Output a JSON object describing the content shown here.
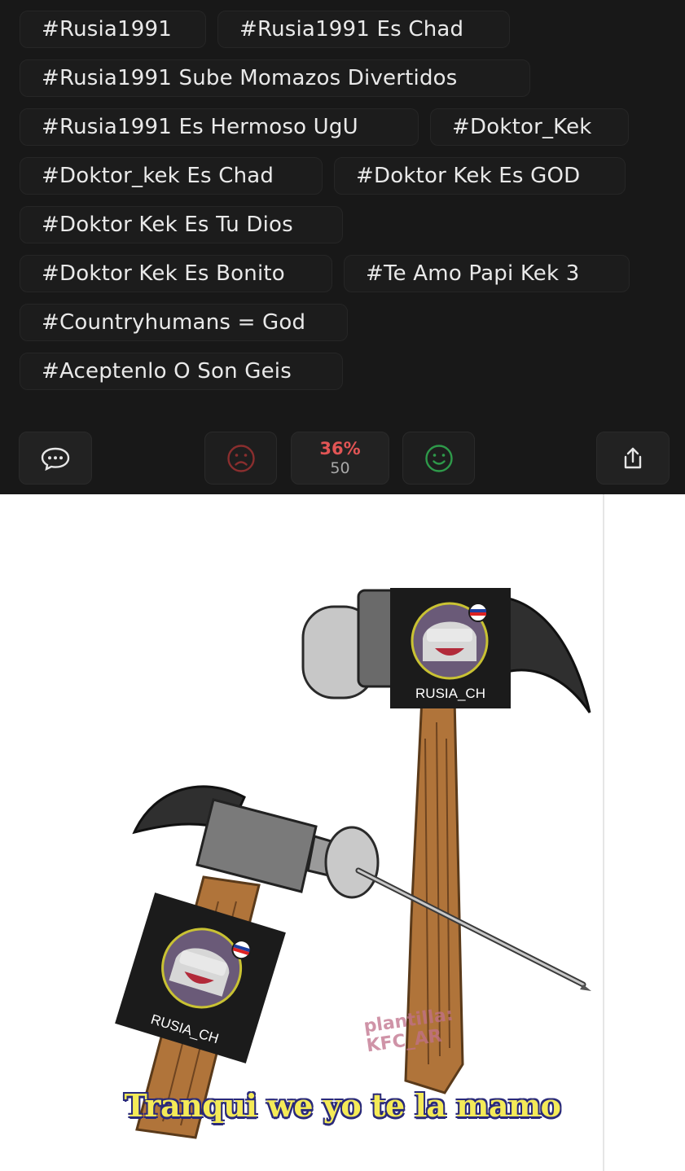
{
  "tags": [
    "#Rusia1991",
    "#Rusia1991 Es Chad",
    "#Rusia1991 Sube Momazos Divertidos",
    "#Rusia1991 Es Hermoso UgU",
    "#Doktor_Kek",
    "#Doktor_kek Es Chad",
    "#Doktor Kek Es GOD",
    "#Doktor Kek Es Tu Dios",
    "#Doktor Kek Es Bonito",
    "#Te Amo Papi Kek 3",
    "#Countryhumans = God",
    "#Aceptenlo O Son Geis"
  ],
  "actions": {
    "comment_icon": "speech-bubble-icon",
    "dislike_icon": "frown-icon",
    "like_icon": "smile-icon",
    "share_icon": "share-icon",
    "score_percent": "36%",
    "score_count": "50",
    "dislike_color": "#8a2e2e",
    "like_color": "#2e9a4a",
    "percent_color": "#e25555"
  },
  "meme": {
    "stamp_top_name": "RUSIA_CH",
    "stamp_bottom_name": "RUSIA_CH",
    "watermark_line1": "plantilla:",
    "watermark_line2": "KFC_AR",
    "caption": "Tranqui we yo te la mamo"
  }
}
